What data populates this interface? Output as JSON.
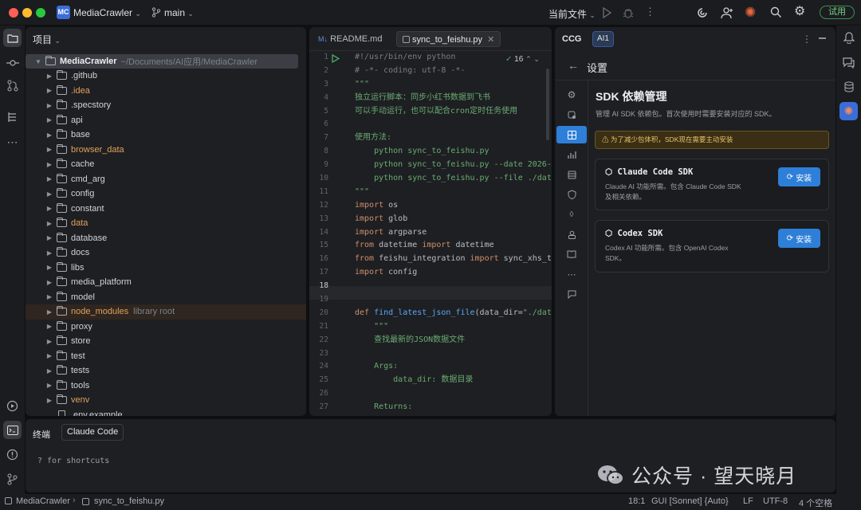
{
  "titlebar": {
    "project_badge": "MC",
    "project_name": "MediaCrawler",
    "branch": "main",
    "run_config": "当前文件",
    "trial_label": "试用"
  },
  "project_panel": {
    "title": "项目",
    "root_name": "MediaCrawler",
    "root_path": "~/Documents/AI应用/MediaCrawler",
    "items": [
      {
        "name": ".github",
        "color": "#d0d3d8",
        "hint": ""
      },
      {
        "name": ".idea",
        "color": "#e0a15c",
        "hint": ""
      },
      {
        "name": ".specstory",
        "color": "#d0d3d8",
        "hint": ""
      },
      {
        "name": "api",
        "color": "#d0d3d8",
        "hint": ""
      },
      {
        "name": "base",
        "color": "#d0d3d8",
        "hint": ""
      },
      {
        "name": "browser_data",
        "color": "#e0a15c",
        "hint": ""
      },
      {
        "name": "cache",
        "color": "#d0d3d8",
        "hint": ""
      },
      {
        "name": "cmd_arg",
        "color": "#d0d3d8",
        "hint": ""
      },
      {
        "name": "config",
        "color": "#d0d3d8",
        "hint": ""
      },
      {
        "name": "constant",
        "color": "#d0d3d8",
        "hint": ""
      },
      {
        "name": "data",
        "color": "#e0a15c",
        "hint": ""
      },
      {
        "name": "database",
        "color": "#d0d3d8",
        "hint": ""
      },
      {
        "name": "docs",
        "color": "#d0d3d8",
        "hint": ""
      },
      {
        "name": "libs",
        "color": "#d0d3d8",
        "hint": ""
      },
      {
        "name": "media_platform",
        "color": "#d0d3d8",
        "hint": ""
      },
      {
        "name": "model",
        "color": "#d0d3d8",
        "hint": ""
      },
      {
        "name": "node_modules",
        "color": "#e0a15c",
        "hint": "library root"
      },
      {
        "name": "proxy",
        "color": "#d0d3d8",
        "hint": ""
      },
      {
        "name": "store",
        "color": "#d0d3d8",
        "hint": ""
      },
      {
        "name": "test",
        "color": "#d0d3d8",
        "hint": ""
      },
      {
        "name": "tests",
        "color": "#d0d3d8",
        "hint": ""
      },
      {
        "name": "tools",
        "color": "#d0d3d8",
        "hint": ""
      },
      {
        "name": "venv",
        "color": "#e0a15c",
        "hint": ""
      },
      {
        "name": ".env.example",
        "color": "#d0d3d8",
        "hint": ""
      }
    ]
  },
  "editor": {
    "tabs": [
      {
        "label": "README.md",
        "prefix": "M↓"
      },
      {
        "label": "sync_to_feishu.py",
        "prefix": ""
      }
    ],
    "warning_count": "16",
    "line_numbers": [
      "1",
      "2",
      "3",
      "4",
      "5",
      "6",
      "7",
      "8",
      "9",
      "10",
      "11",
      "12",
      "13",
      "14",
      "15",
      "16",
      "17",
      "18",
      "19",
      "20",
      "21",
      "22",
      "23",
      "24",
      "25",
      "26",
      "27"
    ],
    "line1": "#!/usr/bin/env python",
    "line2": "# -*- coding: utf-8 -*-",
    "line3": "\"\"\"",
    "line4": "独立运行脚本：同步小红书数据到飞书",
    "line5": "可以手动运行，也可以配合cron定时任务使用",
    "line7": "使用方法:",
    "line8": "    python sync_to_feishu.py",
    "line9": "    python sync_to_feishu.py --date 2026-",
    "line10": "    python sync_to_feishu.py --file ./dat",
    "line11": "\"\"\"",
    "kw_import": "import",
    "kw_from": "from",
    "kw_def": "def",
    "line12_mod": " os",
    "line13_mod": " glob",
    "line14_mod": " argparse",
    "line15_mod": " datetime ",
    "line15_name": " datetime",
    "line16_mod": " feishu_integration ",
    "line16_name": " sync_xhs_t",
    "line17_mod": " config",
    "line20_fn": "find_latest_json_file",
    "line20_rest": "(data_dir=",
    "line20_str": "\"./dat",
    "line21": "    \"\"\"",
    "line22": "    查找最新的JSON数据文件",
    "line24": "    Args:",
    "line25": "        data_dir: 数据目录",
    "line27": "    Returns:"
  },
  "ccg": {
    "title": "CCG",
    "tab": "AI1",
    "back_title": "设置",
    "heading": "SDK 依赖管理",
    "description": "管理 AI SDK 依赖包。首次使用时需要安装对应的 SDK。",
    "notice": "为了减少包体积，SDK现在需要主动安装",
    "cards": [
      {
        "title": "Claude Code SDK",
        "desc1": "Claude AI 功能所需。包含 Claude Code SDK",
        "desc2": "及相关依赖。",
        "button": "安装"
      },
      {
        "title": "Codex SDK",
        "desc1": "Codex AI 功能所需。包含 OpenAI Codex",
        "desc2": "SDK。",
        "button": "安装"
      }
    ]
  },
  "terminal": {
    "title": "终端",
    "tab": "Claude Code",
    "prompt": "? for shortcuts"
  },
  "watermark": "公众号 · 望天晓月",
  "statusbar": {
    "crumb_project": "MediaCrawler",
    "crumb_file": "sync_to_feishu.py",
    "position": "18:1",
    "model": "GUI  [Sonnet] {Auto}",
    "line_ending": "LF",
    "encoding": "UTF-8",
    "indent": "4 个空格"
  },
  "colors": {
    "accent": "#2e7fd8",
    "folder_excluded": "#e0a15c",
    "trial_green": "#7ad28a",
    "notice_bg": "#3a2f14"
  }
}
